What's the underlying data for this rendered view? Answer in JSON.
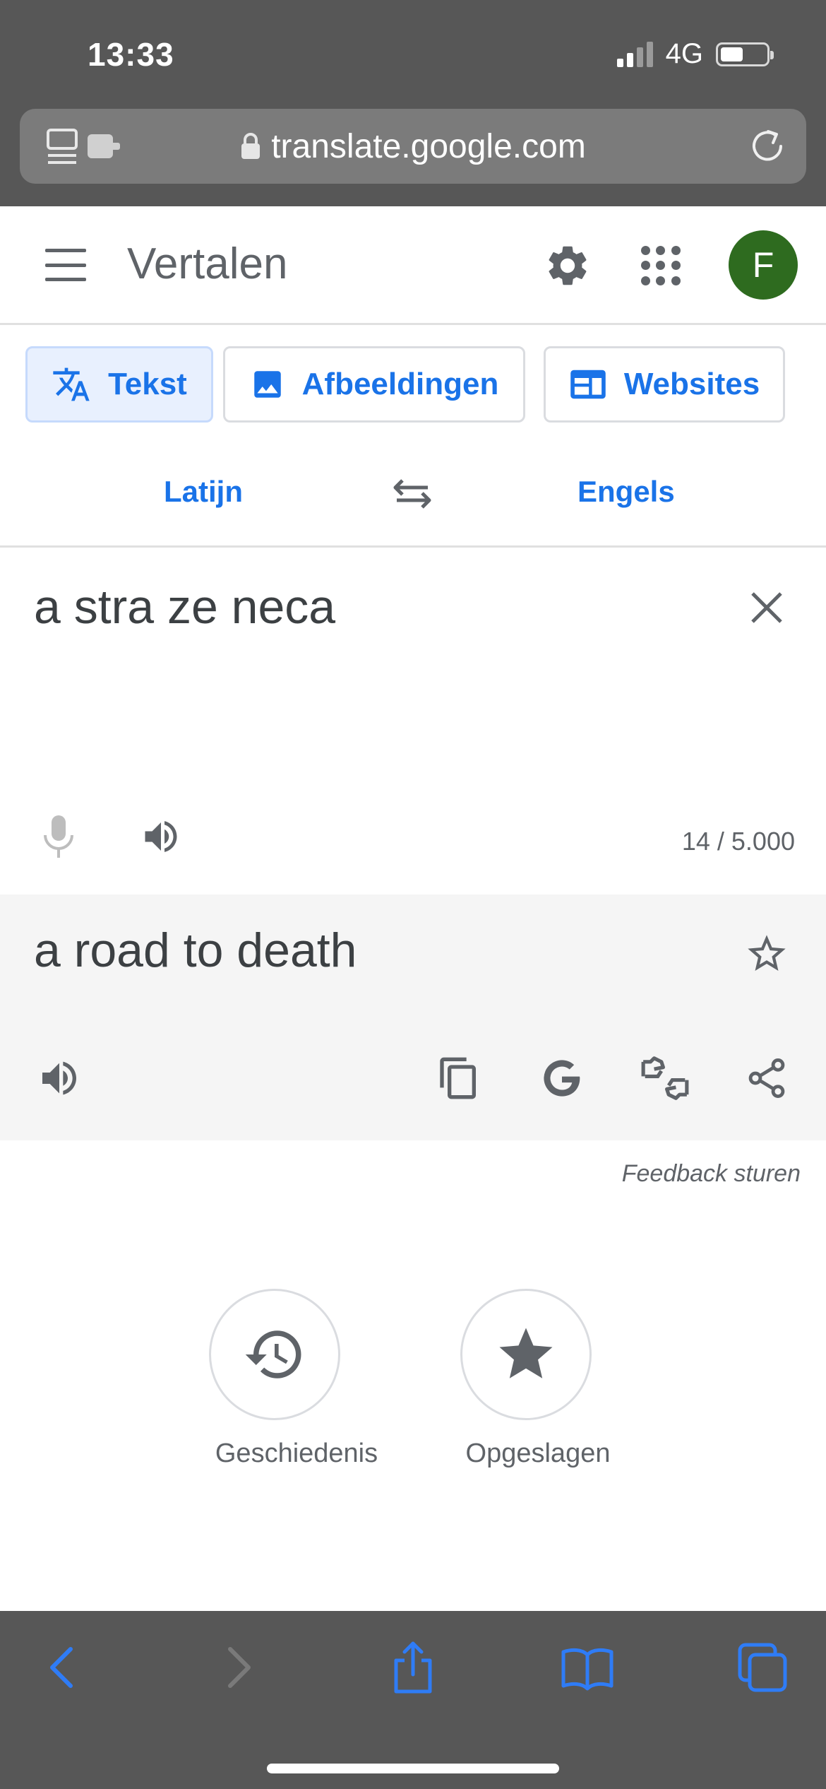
{
  "status_bar": {
    "time": "13:33",
    "network": "4G",
    "battery_level": 0.5
  },
  "browser": {
    "url": "translate.google.com"
  },
  "app_bar": {
    "title": "Vertalen",
    "avatar_letter": "F",
    "avatar_color": "#2e6b1f"
  },
  "modes": [
    {
      "label": "Tekst",
      "active": true
    },
    {
      "label": "Afbeeldingen",
      "active": false
    },
    {
      "label": "Websites",
      "active": false
    }
  ],
  "languages": {
    "source": "Latijn",
    "target": "Engels"
  },
  "source": {
    "text": "a stra ze neca",
    "counter": "14 / 5.000"
  },
  "result": {
    "text": "a road to death"
  },
  "feedback": "Feedback sturen",
  "shortcuts": [
    {
      "label": "Geschiedenis",
      "icon": "history-icon"
    },
    {
      "label": "Opgeslagen",
      "icon": "star-icon"
    }
  ],
  "colors": {
    "accent": "#1a73e8",
    "browser_chrome": "#575757",
    "result_bg": "#f5f5f5"
  }
}
